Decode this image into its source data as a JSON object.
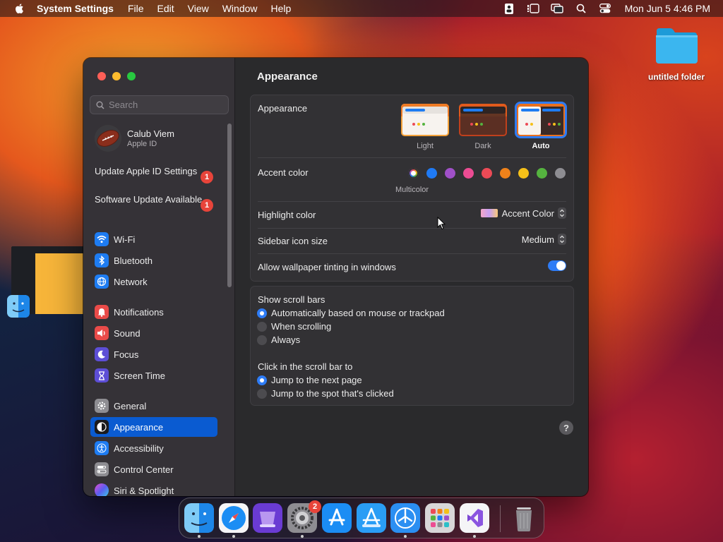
{
  "menubar": {
    "app_name": "System Settings",
    "menus": [
      "File",
      "Edit",
      "View",
      "Window",
      "Help"
    ],
    "clock": "Mon Jun 5  4:46 PM"
  },
  "desktop": {
    "folder_label": "untitled folder"
  },
  "sidebar": {
    "search_placeholder": "Search",
    "profile": {
      "name": "Calub Viem",
      "subtitle": "Apple ID"
    },
    "notices": [
      {
        "label": "Update Apple ID Settings",
        "badge": "1"
      },
      {
        "label": "Software Update Available",
        "badge": "1"
      }
    ],
    "items": [
      {
        "label": "Wi-Fi",
        "icon": "wifi-icon"
      },
      {
        "label": "Bluetooth",
        "icon": "bluetooth-icon"
      },
      {
        "label": "Network",
        "icon": "globe-icon"
      },
      {
        "label": "Notifications",
        "icon": "bell-icon"
      },
      {
        "label": "Sound",
        "icon": "speaker-icon"
      },
      {
        "label": "Focus",
        "icon": "moon-icon"
      },
      {
        "label": "Screen Time",
        "icon": "hourglass-icon"
      },
      {
        "label": "General",
        "icon": "gear-icon"
      },
      {
        "label": "Appearance",
        "icon": "appearance-icon",
        "selected": true
      },
      {
        "label": "Accessibility",
        "icon": "accessibility-icon"
      },
      {
        "label": "Control Center",
        "icon": "toggles-icon"
      },
      {
        "label": "Siri & Spotlight",
        "icon": "siri-icon"
      }
    ]
  },
  "content": {
    "title": "Appearance",
    "appearance": {
      "label": "Appearance",
      "options": [
        "Light",
        "Dark",
        "Auto"
      ],
      "selected": "Auto"
    },
    "accent": {
      "label": "Accent color",
      "colors": [
        "multicolor",
        "#1f7af4",
        "#a050c8",
        "#ec4c93",
        "#ec4a56",
        "#f0821a",
        "#f5c019",
        "#55b33f",
        "#8e8d92"
      ],
      "selected_name": "Multicolor"
    },
    "highlight": {
      "label": "Highlight color",
      "value": "Accent Color"
    },
    "sidebar_icon_size": {
      "label": "Sidebar icon size",
      "value": "Medium"
    },
    "wallpaper_tinting": {
      "label": "Allow wallpaper tinting in windows",
      "enabled": true
    },
    "scroll_bars": {
      "label": "Show scroll bars",
      "options": [
        "Automatically based on mouse or trackpad",
        "When scrolling",
        "Always"
      ],
      "selected": "Automatically based on mouse or trackpad"
    },
    "click_scroll": {
      "label": "Click in the scroll bar to",
      "options": [
        "Jump to the next page",
        "Jump to the spot that's clicked"
      ],
      "selected": "Jump to the next page"
    },
    "help": "?"
  },
  "dock": {
    "apps": [
      "finder-icon",
      "safari-icon",
      "notchmeister-icon",
      "system-settings-icon",
      "app-store-icon",
      "xcode-icon",
      "testflight-icon",
      "launchpad-icon",
      "visual-studio-icon",
      "trash-icon"
    ],
    "settings_badge": "2"
  }
}
